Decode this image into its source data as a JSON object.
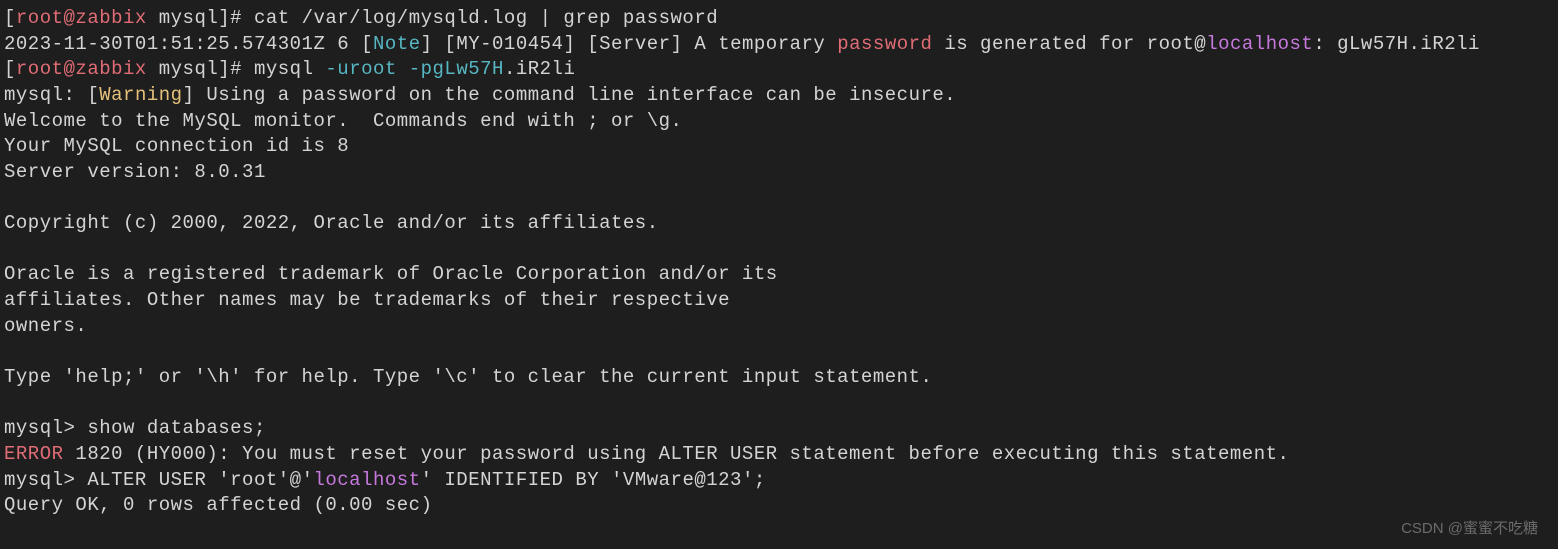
{
  "line1": {
    "userhost": "root@zabbix",
    "dir": "mysql",
    "cmd": "cat /var/log/mysqld.log | grep password"
  },
  "line2": {
    "timestamp": "2023-11-30T01:51:25.574301Z",
    "num": "6",
    "note": "Note",
    "code": "MY-010454",
    "server": "Server",
    "text1": "A temporary",
    "password": "password",
    "text2": "is generated for root@",
    "localhost": "localhost",
    "text3": ": gLw57H.iR2li"
  },
  "line3": {
    "userhost": "root@zabbix",
    "dir": "mysql",
    "cmd1": "mysql",
    "opt1": "-uroot",
    "opt2": "-pgLw57H",
    "opt3": ".iR2li"
  },
  "line4": {
    "prefix": "mysql: ",
    "warning": "Warning",
    "text": "Using a password on the command line interface can be insecure."
  },
  "line5": "Welcome to the MySQL monitor.  Commands end with ; or \\g.",
  "line6": "Your MySQL connection id is 8",
  "line7": "Server version: 8.0.31",
  "line8": "Copyright (c) 2000, 2022, Oracle and/or its affiliates.",
  "line9": "Oracle is a registered trademark of Oracle Corporation and/or its",
  "line10": "affiliates. Other names may be trademarks of their respective",
  "line11": "owners.",
  "line12": "Type 'help;' or '\\h' for help. Type '\\c' to clear the current input statement.",
  "line13": {
    "prompt": "mysql>",
    "cmd": "show databases;"
  },
  "line14": {
    "error": "ERROR",
    "text": "1820 (HY000): You must reset your password using ALTER USER statement before executing this statement."
  },
  "line15": {
    "prompt": "mysql>",
    "cmd1": "ALTER USER 'root'@",
    "localhost": "localhost",
    "cmd2": " IDENTIFIED BY 'VMware@123';"
  },
  "line16": "Query OK, 0 rows affected (0.00 sec)",
  "watermark": "CSDN @蜜蜜不吃糖"
}
